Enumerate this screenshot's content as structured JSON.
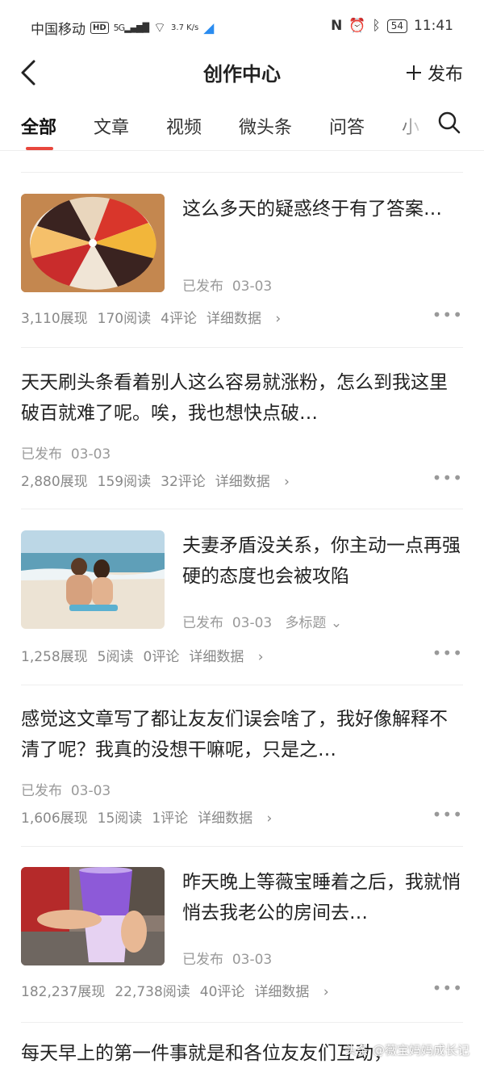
{
  "statusbar": {
    "carrier": "中国移动",
    "hd": "HD",
    "signal": "5G",
    "speed": "3.7 K/s",
    "battery": "54",
    "time": "11:41"
  },
  "header": {
    "title": "创作中心",
    "publish_label": "发布"
  },
  "tabs": [
    {
      "label": "全部"
    },
    {
      "label": "文章"
    },
    {
      "label": "视频"
    },
    {
      "label": "微头条"
    },
    {
      "label": "问答"
    },
    {
      "label": "小"
    }
  ],
  "items": [
    {
      "title": "这么多天的疑惑终于有了答案…",
      "status": "已发布",
      "date": "03-03",
      "views": "3,110展现",
      "reads": "170阅读",
      "comments": "4评论",
      "details": "详细数据",
      "thumb": "cake"
    },
    {
      "title": "天天刷头条看着别人这么容易就涨粉，怎么到我这里破百就难了呢。唉，我也想快点破…",
      "status": "已发布",
      "date": "03-03",
      "views": "2,880展现",
      "reads": "159阅读",
      "comments": "32评论",
      "details": "详细数据"
    },
    {
      "title": "夫妻矛盾没关系，你主动一点再强硬的态度也会被攻陷",
      "status": "已发布",
      "date": "03-03",
      "multi_title": "多标题",
      "views": "1,258展现",
      "reads": "5阅读",
      "comments": "0评论",
      "details": "详细数据",
      "thumb": "beach"
    },
    {
      "title": "感觉这文章写了都让友友们误会啥了，我好像解释不清了呢？我真的没想干嘛呢，只是之…",
      "status": "已发布",
      "date": "03-03",
      "views": "1,606展现",
      "reads": "15阅读",
      "comments": "1评论",
      "details": "详细数据"
    },
    {
      "title": "昨天晚上等薇宝睡着之后，我就悄悄去我老公的房间去…",
      "status": "已发布",
      "date": "03-03",
      "views": "182,237展现",
      "reads": "22,738阅读",
      "comments": "40评论",
      "details": "详细数据",
      "thumb": "drink"
    },
    {
      "title": "每天早上的第一件事就是和各位友友们互动，"
    }
  ],
  "watermark": "头条 @薇宝妈妈成长记"
}
